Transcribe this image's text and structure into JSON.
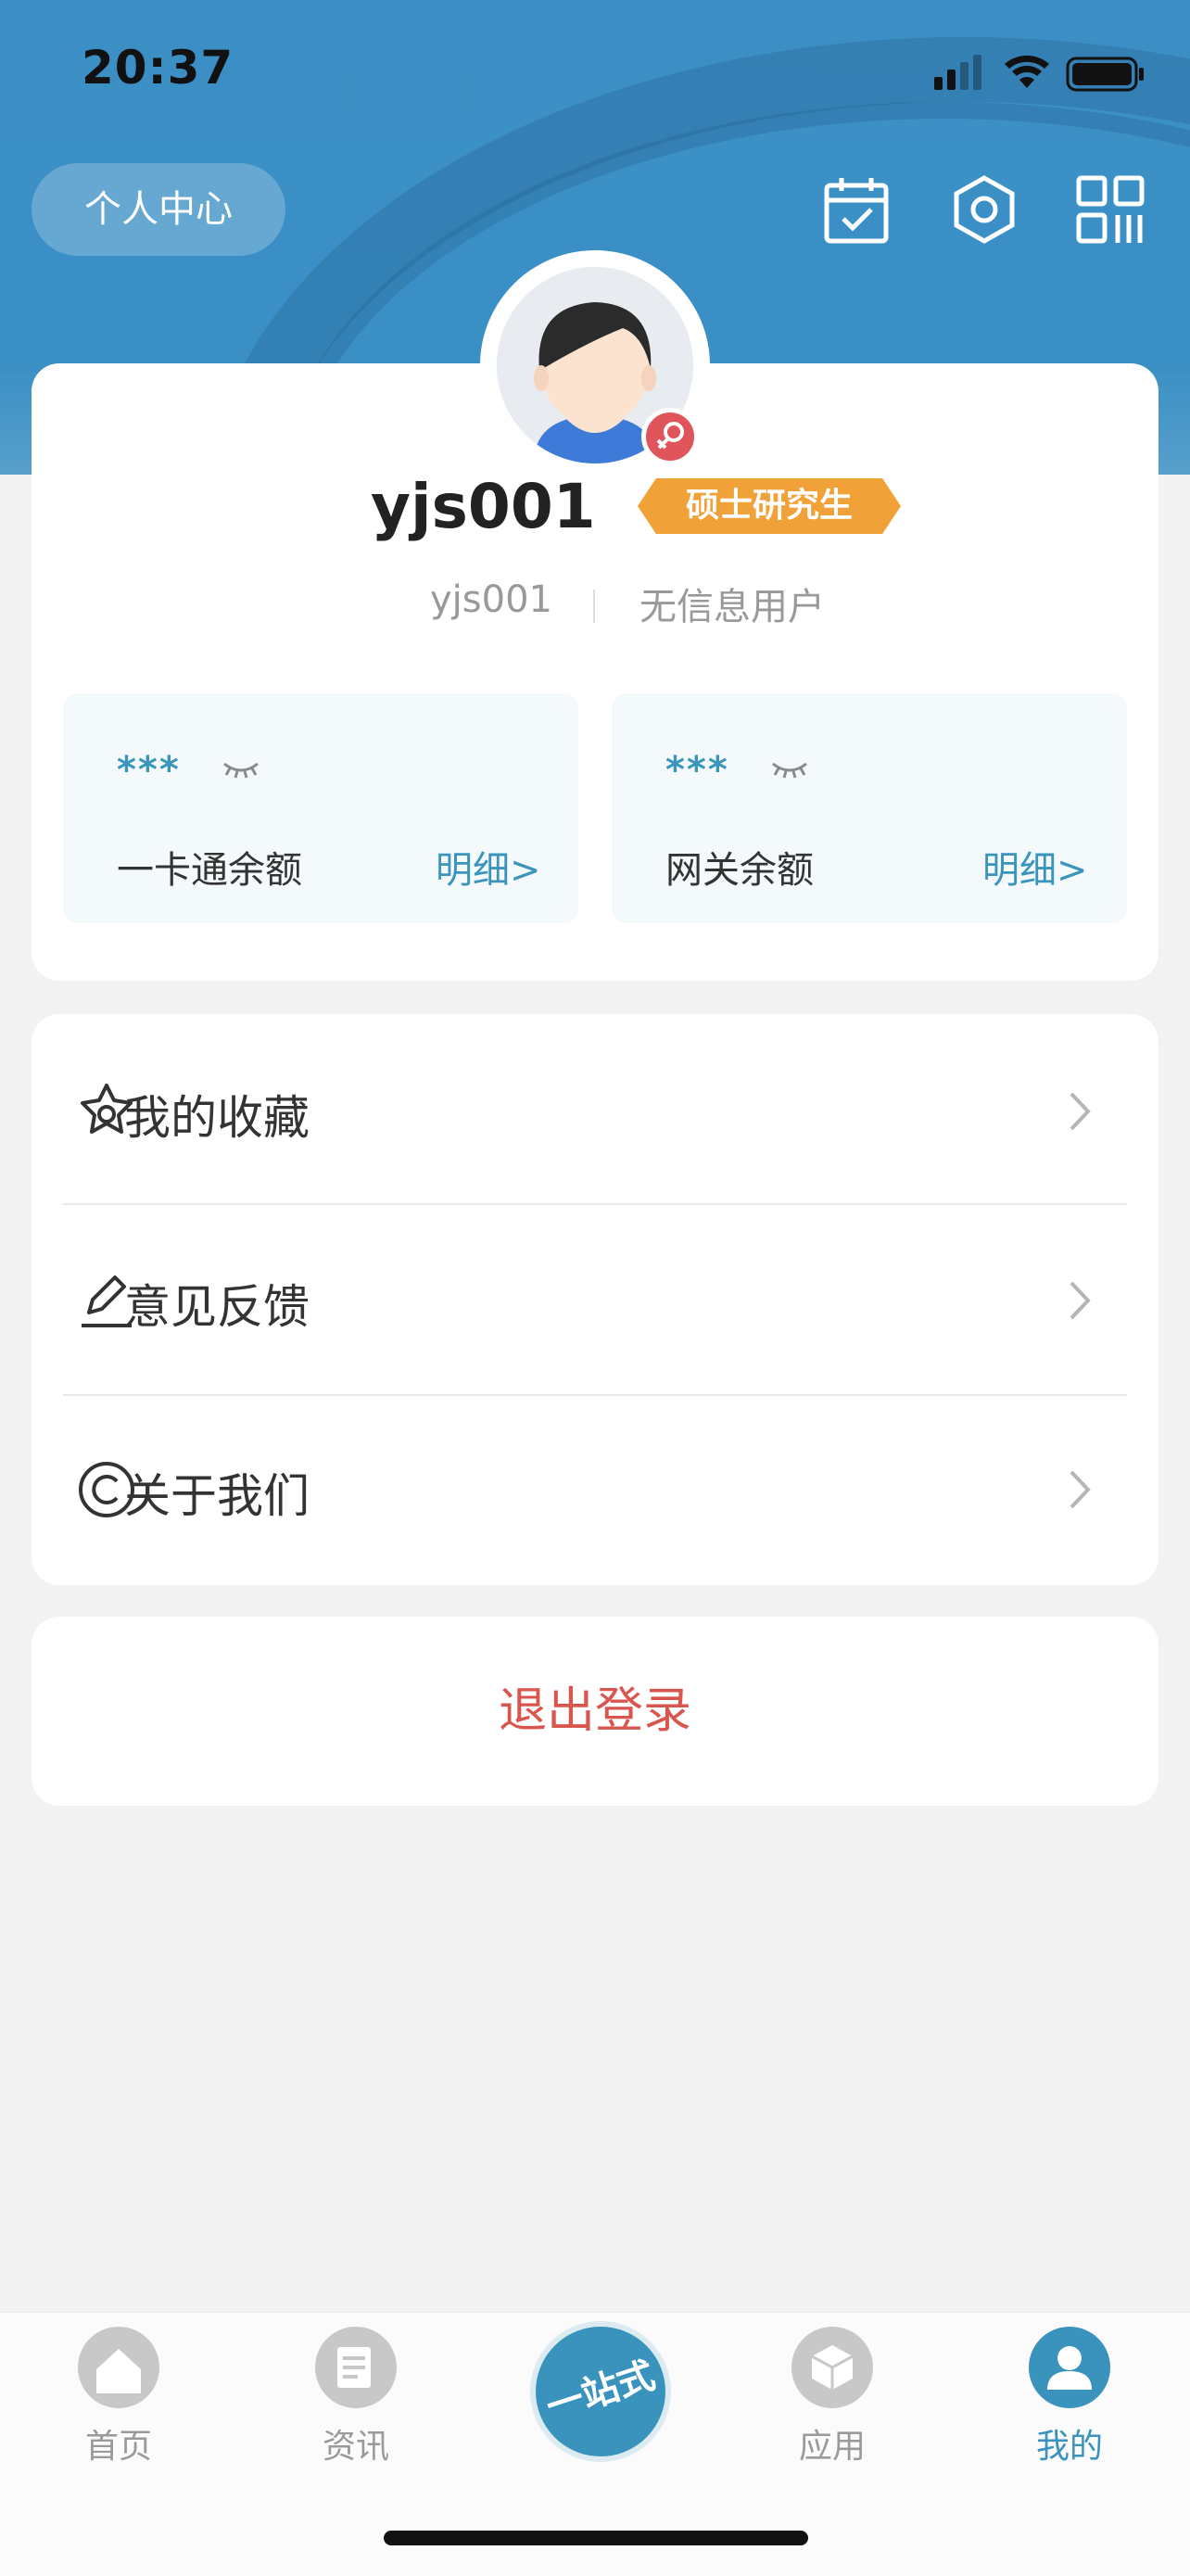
{
  "status_bar": {
    "time": "20:37"
  },
  "header": {
    "title": "个人中心"
  },
  "profile": {
    "name": "yjs001",
    "degree": "硕士研究生",
    "id": "yjs001",
    "user_type": "无信息用户"
  },
  "balances": [
    {
      "masked_value": "***",
      "label": "一卡通余额",
      "link": "明细>"
    },
    {
      "masked_value": "***",
      "label": "网关余额",
      "link": "明细>"
    }
  ],
  "menu": [
    {
      "label": "我的收藏",
      "icon": "star-outline-icon"
    },
    {
      "label": "意见反馈",
      "icon": "pencil-icon"
    },
    {
      "label": "关于我们",
      "icon": "copyright-icon"
    }
  ],
  "logout_label": "退出登录",
  "tabs": [
    {
      "label": "首页",
      "icon": "home-icon"
    },
    {
      "label": "",
      "icon": "center-logo",
      "logo_text": "一站式"
    },
    {
      "label": "资讯",
      "icon": "news-icon"
    },
    {
      "label": "应用",
      "icon": "box-icon"
    },
    {
      "label": "我的",
      "icon": "user-icon",
      "active": true
    }
  ],
  "colors": {
    "header": "#3a90c6",
    "accent": "#3b95bb",
    "badge": "#f0a238",
    "logout": "#d9564f",
    "gender_badge": "#e0555b"
  }
}
